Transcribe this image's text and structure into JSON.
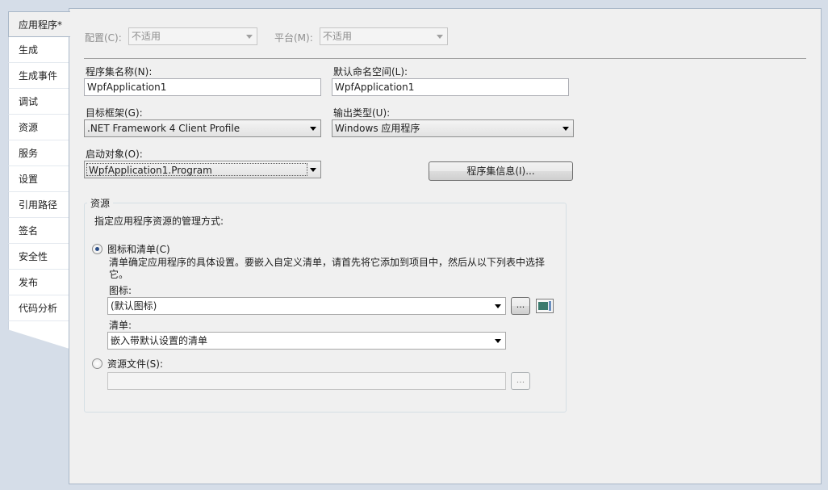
{
  "tabs": [
    {
      "label": "应用程序*",
      "active": true
    },
    {
      "label": "生成"
    },
    {
      "label": "生成事件"
    },
    {
      "label": "调试"
    },
    {
      "label": "资源"
    },
    {
      "label": "服务"
    },
    {
      "label": "设置"
    },
    {
      "label": "引用路径"
    },
    {
      "label": "签名"
    },
    {
      "label": "安全性"
    },
    {
      "label": "发布"
    },
    {
      "label": "代码分析"
    }
  ],
  "config": {
    "label": "配置(C):",
    "value": "不适用",
    "platform_label": "平台(M):",
    "platform_value": "不适用"
  },
  "assembly": {
    "name_label": "程序集名称(N):",
    "name_value": "WpfApplication1",
    "namespace_label": "默认命名空间(L):",
    "namespace_value": "WpfApplication1",
    "framework_label": "目标框架(G):",
    "framework_value": ".NET Framework 4 Client Profile",
    "output_label": "输出类型(U):",
    "output_value": "Windows 应用程序",
    "startup_label": "启动对象(O):",
    "startup_value": "WpfApplication1.Program",
    "info_button": "程序集信息(I)..."
  },
  "resources": {
    "group_title": "资源",
    "description": "指定应用程序资源的管理方式:",
    "icon_manifest_label": "图标和清单(C)",
    "icon_manifest_desc": "清单确定应用程序的具体设置。要嵌入自定义清单，请首先将它添加到项目中，然后从以下列表中选择它。",
    "icon_label": "图标:",
    "icon_value": "(默认图标)",
    "browse_label": "...",
    "manifest_label": "清单:",
    "manifest_value": "嵌入带默认设置的清单",
    "resource_file_label": "资源文件(S):",
    "resource_file_value": "",
    "resource_browse_label": "..."
  }
}
